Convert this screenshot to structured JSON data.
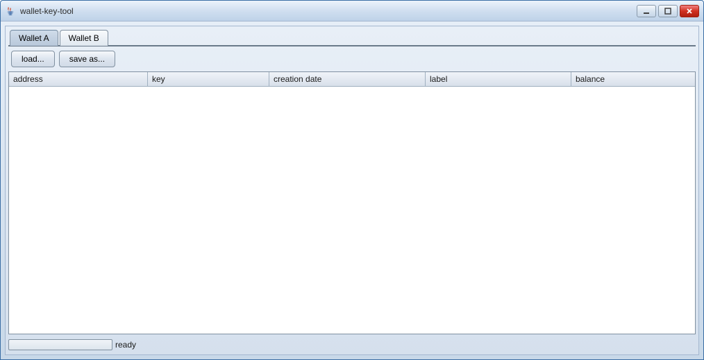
{
  "window": {
    "title": "wallet-key-tool"
  },
  "tabs": [
    {
      "label": "Wallet A",
      "active": true
    },
    {
      "label": "Wallet B",
      "active": false
    }
  ],
  "toolbar": {
    "load_label": "load...",
    "save_as_label": "save as..."
  },
  "table": {
    "columns": [
      {
        "label": "address"
      },
      {
        "label": "key"
      },
      {
        "label": "creation date"
      },
      {
        "label": "label"
      },
      {
        "label": "balance"
      }
    ],
    "rows": []
  },
  "status": {
    "text": "ready",
    "progress": 0
  }
}
